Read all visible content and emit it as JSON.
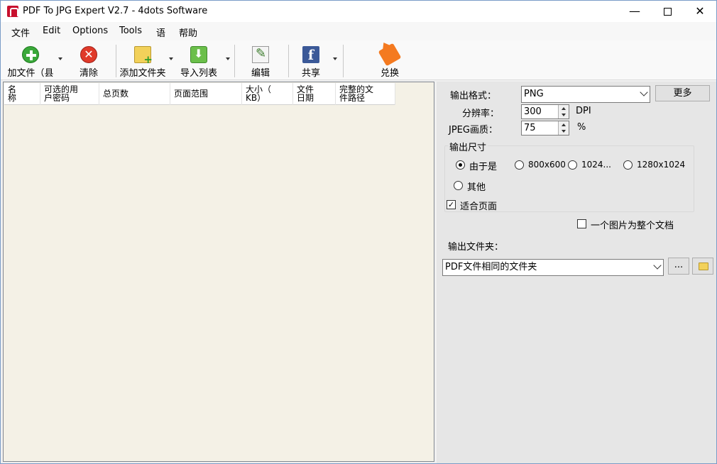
{
  "window": {
    "title": "PDF To JPG Expert V2.7 - 4dots Software",
    "controls": {
      "minimize": "—",
      "close": "✕"
    }
  },
  "menu": [
    "文件",
    "Edit",
    "Options",
    "Tools",
    "语",
    "帮助"
  ],
  "toolbar": {
    "add_file": "加文件（县",
    "clear": "清除",
    "add_folder": "添加文件夹",
    "import_list": "导入列表",
    "edit": "编辑",
    "share": "共享",
    "convert": "兑换",
    "share_icon_text": "f",
    "clear_icon_text": "✕"
  },
  "table": {
    "columns": [
      "名\n称",
      "可选的用\n户密码",
      "总页数",
      "页面范围",
      "大小（\nKB）",
      "文件\n日期",
      "完整的文\n件路径"
    ],
    "rows": []
  },
  "settings": {
    "output_format_label": "输出格式：",
    "output_format_value": "PNG",
    "more_button": "更多",
    "resolution_label": "分辨率：",
    "resolution_value": "300",
    "resolution_unit": "DPI",
    "jpeg_quality_label": "JPEG画质：",
    "jpeg_quality_value": "75",
    "jpeg_quality_unit": "%",
    "output_size_label": "输出尺寸",
    "size_options": [
      "由于是",
      "800x600",
      "1024...",
      "1280x1024",
      "其他"
    ],
    "size_selected": "由于是",
    "fit_page_label": "适合页面",
    "fit_page_checked": true,
    "check_mark": "✓",
    "one_image_label": "一个图片为整个文档",
    "one_image_checked": false,
    "output_folder_label": "输出文件夹：",
    "output_folder_value": "PDF文件相同的文件夹",
    "browse_button": "..."
  },
  "colors": {
    "list_background": "#f4f1e6",
    "panel_background": "#e6e6e6",
    "accent_red": "#c8102e"
  }
}
